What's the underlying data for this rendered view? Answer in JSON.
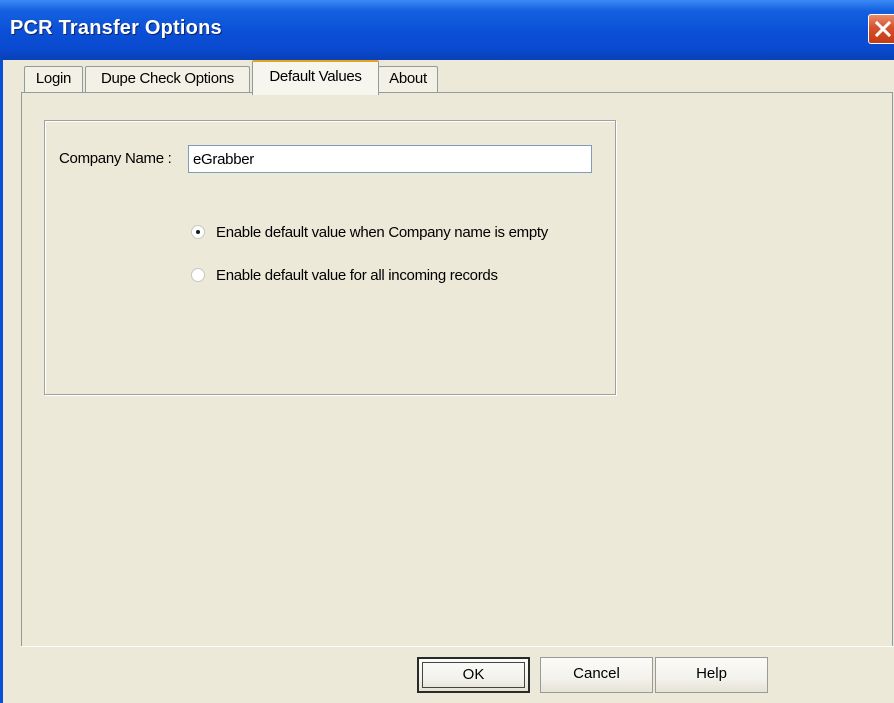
{
  "window": {
    "title": "PCR Transfer Options",
    "close_icon": "close-icon"
  },
  "tabs": [
    {
      "label": "Login",
      "active": false
    },
    {
      "label": "Dupe Check Options",
      "active": false
    },
    {
      "label": "Default Values",
      "active": true
    },
    {
      "label": "About",
      "active": false
    }
  ],
  "form": {
    "company_label": "Company Name :",
    "company_value": "eGrabber",
    "radio_options": [
      {
        "label": "Enable default value when Company name is empty",
        "checked": true
      },
      {
        "label": "Enable default value for all incoming records",
        "checked": false
      }
    ]
  },
  "buttons": {
    "ok": "OK",
    "cancel": "Cancel",
    "help": "Help"
  },
  "colors": {
    "titlebar": "#0a4fd6",
    "dialog_bg": "#ece9d8",
    "close_button": "#d5512c"
  }
}
